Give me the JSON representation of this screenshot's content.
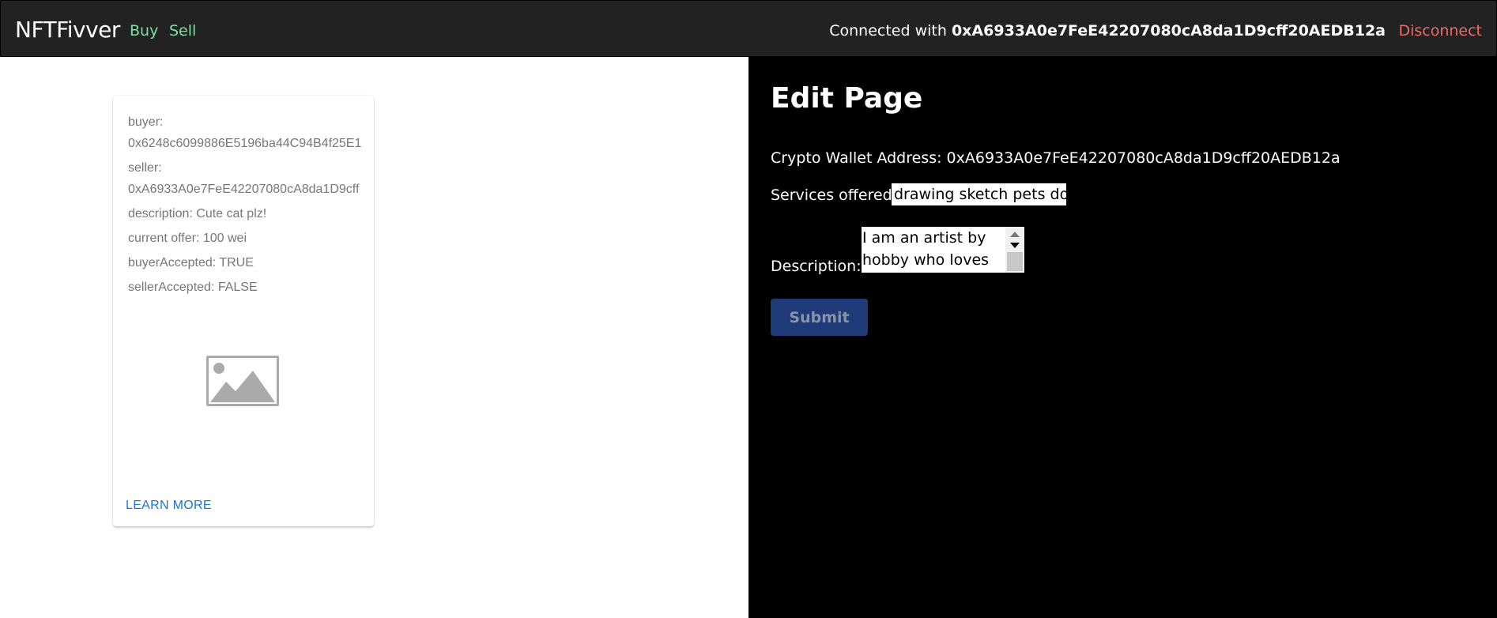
{
  "navbar": {
    "brand": "NFTFivver",
    "links": [
      "Buy",
      "Sell"
    ],
    "connected_prefix": "Connected with ",
    "connected_address": "0xA6933A0e7FeE42207080cA8da1D9cff20AEDB12a",
    "disconnect_label": "Disconnect"
  },
  "card": {
    "buyer_label": "buyer:",
    "buyer_value": "0x6248c6099886E5196ba44C94B4f25E1",
    "seller_label": "seller:",
    "seller_value": "0xA6933A0e7FeE42207080cA8da1D9cff",
    "description": "description: Cute cat plz!",
    "current_offer": "current offer: 100 wei",
    "buyer_accepted": "buyerAccepted: TRUE",
    "seller_accepted": "sellerAccepted: FALSE",
    "image_icon": "image-placeholder-icon",
    "learn_more_label": "LEARN MORE"
  },
  "edit": {
    "title": "Edit Page",
    "wallet_text": "Crypto Wallet Address: 0xA6933A0e7FeE42207080cA8da1D9cff20AEDB12a",
    "services_label": "Services offered:",
    "services_value": "drawing sketch pets dogs",
    "description_label": "Description:",
    "description_value": "I am an artist by hobby who loves",
    "submit_label": "Submit"
  },
  "colors": {
    "navbar_bg": "#222222",
    "nav_link": "#7ee0a0",
    "disconnect": "#f06a6a",
    "submit_bg": "#1f3b78",
    "learn_more": "#1976d2"
  }
}
